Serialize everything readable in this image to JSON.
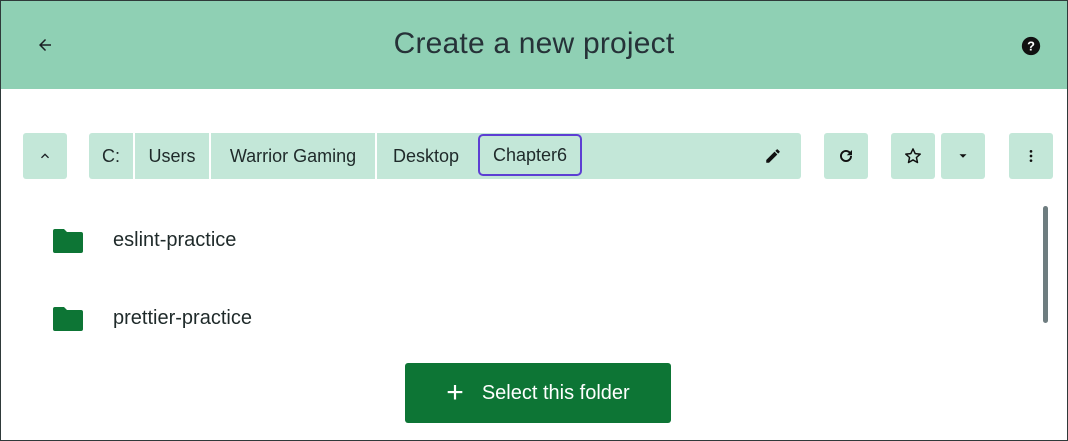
{
  "header": {
    "title": "Create a new project",
    "back_icon": "arrow-left-icon",
    "help_icon": "help-circle-icon",
    "background": "#8fd0b4"
  },
  "toolbar": {
    "up_icon": "chevron-up-icon",
    "path": [
      "C:",
      "Users",
      "Warrior Gaming",
      "Desktop",
      "Chapter6"
    ],
    "active_crumb": "Chapter6",
    "edit_icon": "pencil-icon",
    "refresh_icon": "refresh-icon",
    "favorite_icon": "star-outline-icon",
    "dropdown_icon": "caret-down-icon",
    "more_icon": "more-vertical-icon",
    "button_background": "#c3e7d8",
    "active_border": "#5d3fd3"
  },
  "folders": [
    {
      "name": "eslint-practice",
      "icon": "folder-icon"
    },
    {
      "name": "prettier-practice",
      "icon": "folder-icon"
    }
  ],
  "folder_color": "#0d7535",
  "footer": {
    "select_label": "Select this folder",
    "select_icon": "plus-icon",
    "accent": "#0d7535"
  }
}
